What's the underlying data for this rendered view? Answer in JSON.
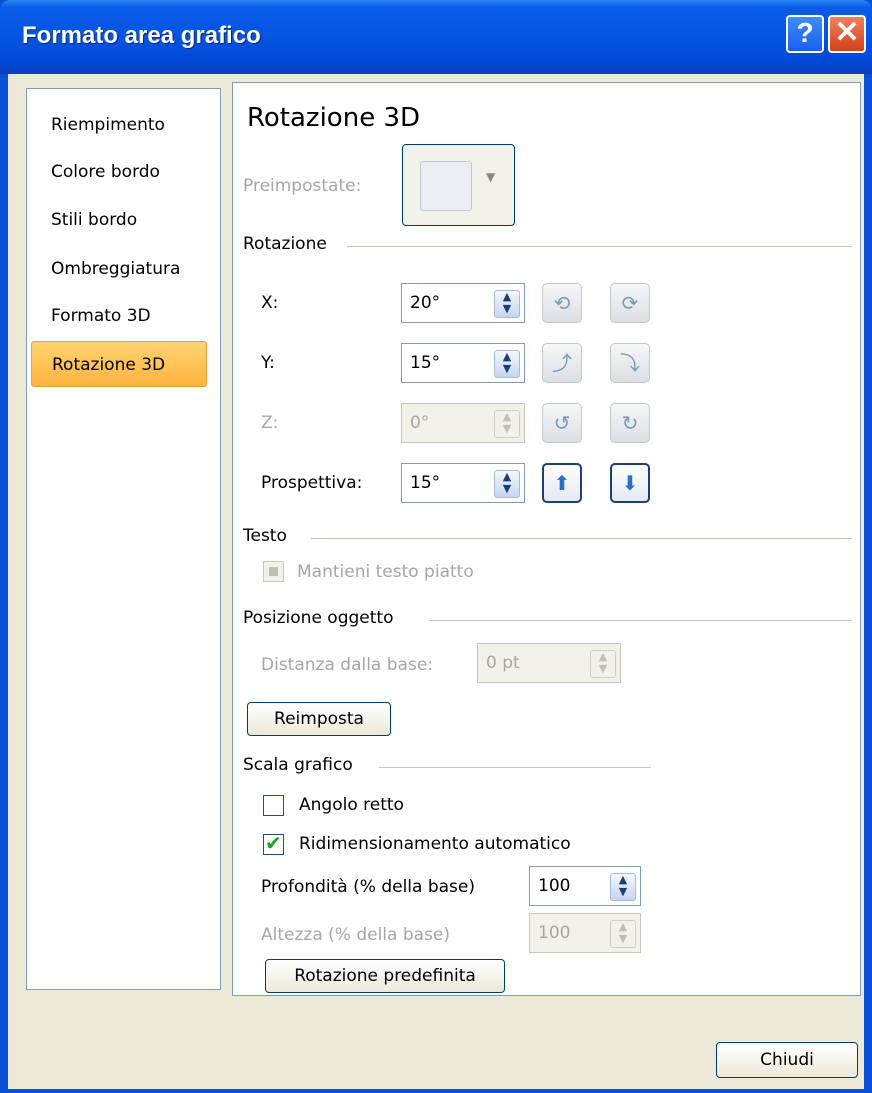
{
  "window": {
    "title": "Formato area grafico",
    "help": "?",
    "close": "✕"
  },
  "nav": {
    "items": [
      {
        "label": "Riempimento"
      },
      {
        "label": "Colore bordo"
      },
      {
        "label": "Stili bordo"
      },
      {
        "label": "Ombreggiatura"
      },
      {
        "label": "Formato 3D"
      },
      {
        "label": "Rotazione 3D"
      }
    ],
    "selected": "Rotazione 3D"
  },
  "panel": {
    "heading": "Rotazione 3D",
    "preset_label": "Preimpostate:",
    "rotation_section": "Rotazione",
    "x_label": "X:",
    "x_value": "20°",
    "y_label": "Y:",
    "y_value": "15°",
    "z_label": "Z:",
    "z_value": "0°",
    "perspective_label": "Prospettiva:",
    "perspective_value": "15°",
    "text_section": "Testo",
    "keep_text_flat": "Mantieni testo piatto",
    "object_position_section": "Posizione oggetto",
    "distance_label": "Distanza dalla base:",
    "distance_value": "0 pt",
    "reset_button": "Reimposta",
    "scale_section": "Scala grafico",
    "right_angle_axes": "Angolo retto",
    "autoscale": "Ridimensionamento automatico",
    "depth_label": "Profondità (% della base)",
    "depth_value": "100",
    "height_label": "Altezza (% della base)",
    "height_value": "100",
    "default_rotation_button": "Rotazione predefinita"
  },
  "footer": {
    "close_button": "Chiudi"
  },
  "colors": {
    "titlebar": "#0554e3",
    "selection": "#ffc14e",
    "client": "#ece9d8"
  }
}
